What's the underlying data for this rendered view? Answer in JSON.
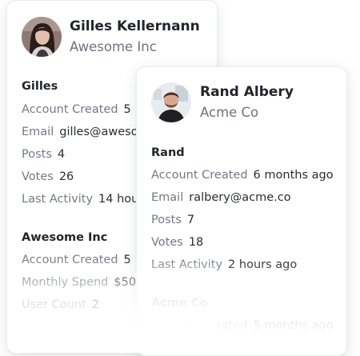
{
  "cards": [
    {
      "name": "Gilles Kellernann",
      "company": "Awesome Inc",
      "user_section": {
        "title": "Gilles",
        "rows": [
          {
            "label": "Account Created",
            "value": "5"
          },
          {
            "label": "Email",
            "value": "gilles@aweso"
          },
          {
            "label": "Posts",
            "value": "4"
          },
          {
            "label": "Votes",
            "value": "26"
          },
          {
            "label": "Last Activity",
            "value": "14 hou"
          }
        ]
      },
      "company_section": {
        "title": "Awesome Inc",
        "rows": [
          {
            "label": "Account Created",
            "value": "5"
          },
          {
            "label": "Monthly Spend",
            "value": "$50"
          },
          {
            "label": "User Count",
            "value": "2"
          }
        ]
      }
    },
    {
      "name": "Rand Albery",
      "company": "Acme Co",
      "user_section": {
        "title": "Rand",
        "rows": [
          {
            "label": "Account Created",
            "value": "6 months ago"
          },
          {
            "label": "Email",
            "value": "ralbery@acme.co"
          },
          {
            "label": "Posts",
            "value": "7"
          },
          {
            "label": "Votes",
            "value": "18"
          },
          {
            "label": "Last Activity",
            "value": "2 hours ago"
          }
        ]
      },
      "company_section": {
        "title": "Acme Co",
        "rows": [
          {
            "label": "Account Created",
            "value": "5 months ago"
          }
        ]
      }
    }
  ]
}
